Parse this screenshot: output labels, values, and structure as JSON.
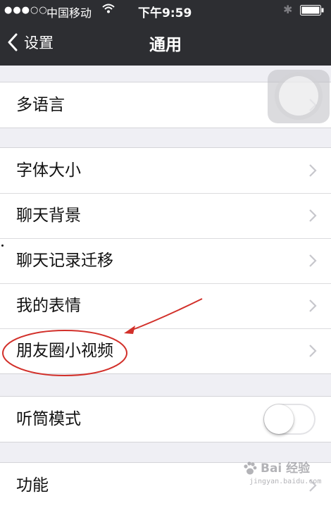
{
  "status_bar": {
    "signal": "●●●○○",
    "carrier": "中国移动",
    "time": "下午9:59"
  },
  "nav": {
    "back_label": "设置",
    "title": "通用"
  },
  "groups": {
    "language": {
      "label": "多语言"
    },
    "display": {
      "font_size": "字体大小",
      "chat_background": "聊天背景",
      "chat_migration": "聊天记录迁移",
      "my_stickers": "我的表情",
      "moments_video": "朋友圈小视频"
    },
    "earpiece": {
      "label": "听筒模式",
      "enabled": false
    },
    "features": {
      "label": "功能"
    }
  },
  "watermark": {
    "text": "Bai 经验",
    "sub": "jingyan.baidu.com"
  },
  "colors": {
    "nav_background": "#2d2e32",
    "page_background": "#efeff4",
    "annotation_red": "#d2302a"
  }
}
